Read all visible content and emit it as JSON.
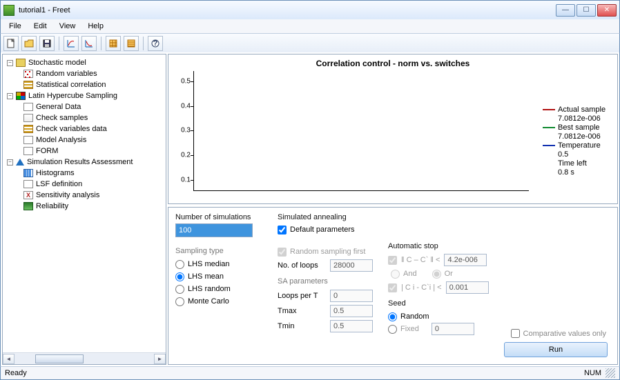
{
  "window": {
    "title": "tutorial1 - Freet"
  },
  "menu": {
    "file": "File",
    "edit": "Edit",
    "view": "View",
    "help": "Help"
  },
  "tree": {
    "n_stochastic": "Stochastic model",
    "n_randvars": "Random variables",
    "n_statcorr": "Statistical correlation",
    "n_lhs": "Latin Hypercube Sampling",
    "n_general": "General Data",
    "n_checksamp": "Check samples",
    "n_checkvar": "Check variables data",
    "n_modelan": "Model Analysis",
    "n_form": "FORM",
    "n_sra": "Simulation Results Assessment",
    "n_hist": "Histograms",
    "n_lsf": "LSF definition",
    "n_sens": "Sensitivity analysis",
    "n_rel": "Reliability"
  },
  "chart_data": {
    "type": "line",
    "title": "Correlation control - norm vs. switches",
    "xlabel": "",
    "ylabel": "",
    "ylim": [
      0,
      0.55
    ],
    "yticks": [
      0.1,
      0.2,
      0.3,
      0.4,
      0.5
    ],
    "series": [
      {
        "name": "Actual sample",
        "color": "#b01010",
        "value_label": "7.0812e-006",
        "values": []
      },
      {
        "name": "Best sample",
        "color": "#108a30",
        "value_label": "7.0812e-006",
        "values": []
      },
      {
        "name": "Temperature",
        "color": "#1030b0",
        "value_label": "0.5",
        "values": []
      }
    ],
    "extra": {
      "time_left_label": "Time left",
      "time_left_value": "0.8 s"
    }
  },
  "settings": {
    "numsim_label": "Number of simulations",
    "numsim_value": "100",
    "sampling_label": "Sampling type",
    "sampling": {
      "lhs_median": "LHS median",
      "lhs_mean": "LHS mean",
      "lhs_random": "LHS random",
      "monte_carlo": "Monte Carlo"
    },
    "sa_group": "Simulated annealing",
    "default_params": "Default parameters",
    "random_first": "Random sampling first",
    "no_loops_label": "No. of loops",
    "no_loops_value": "28000",
    "sa_params_label": "SA parameters",
    "loops_per_t_label": "Loops per T",
    "loops_per_t_value": "0",
    "tmax_label": "Tmax",
    "tmax_value": "0.5",
    "tmin_label": "Tmin",
    "tmin_value": "0.5",
    "auto_stop_label": "Automatic stop",
    "cc_label": "‖ C – C` ‖ <",
    "cc_value": "4.2e-006",
    "and_label": "And",
    "or_label": "Or",
    "ci_label": "| C i - C`i | <",
    "ci_value": "0.001",
    "seed_label": "Seed",
    "seed_random": "Random",
    "seed_fixed": "Fixed",
    "seed_value": "0",
    "comparative": "Comparative values only",
    "run": "Run"
  },
  "status": {
    "ready": "Ready",
    "num": "NUM"
  }
}
